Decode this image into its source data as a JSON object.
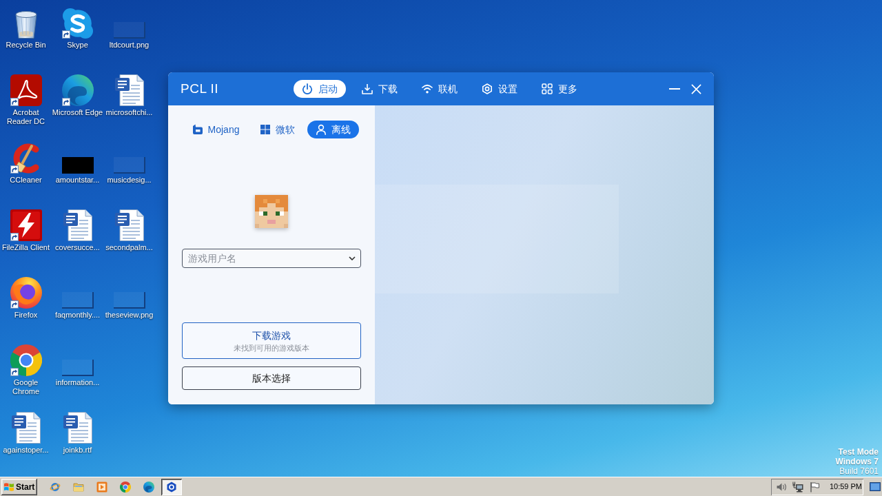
{
  "desktop": {
    "icons": [
      {
        "label": "Recycle Bin",
        "kind": "bin",
        "shortcut": false
      },
      {
        "label": "Acrobat Reader DC",
        "kind": "acrobat",
        "shortcut": true
      },
      {
        "label": "CCleaner",
        "kind": "ccleaner",
        "shortcut": true
      },
      {
        "label": "FileZilla Client",
        "kind": "filezilla",
        "shortcut": true
      },
      {
        "label": "Firefox",
        "kind": "firefox",
        "shortcut": true
      },
      {
        "label": "Google Chrome",
        "kind": "chrome",
        "shortcut": true
      },
      {
        "label": "againstoper...",
        "kind": "document",
        "shortcut": false
      },
      {
        "label": "Skype",
        "kind": "skype",
        "shortcut": true
      },
      {
        "label": "Microsoft Edge",
        "kind": "edge",
        "shortcut": true
      },
      {
        "label": "amountstar...",
        "kind": "darkimage",
        "shortcut": false
      },
      {
        "label": "coversucce...",
        "kind": "document",
        "shortcut": false
      },
      {
        "label": "faqmonthly....",
        "kind": "image",
        "shortcut": false
      },
      {
        "label": "information...",
        "kind": "image",
        "shortcut": false
      },
      {
        "label": "joinkb.rtf",
        "kind": "document",
        "shortcut": false
      },
      {
        "label": "ltdcourt.png",
        "kind": "image",
        "shortcut": false
      },
      {
        "label": "microsoftchi...",
        "kind": "document",
        "shortcut": false
      },
      {
        "label": "musicdesig...",
        "kind": "image",
        "shortcut": false
      },
      {
        "label": "secondpalm...",
        "kind": "document",
        "shortcut": false
      },
      {
        "label": "theseview.png",
        "kind": "image",
        "shortcut": false
      }
    ],
    "system_notice": {
      "mode": "Test Mode",
      "edition": "Windows 7",
      "build": "Build 7601"
    }
  },
  "window": {
    "title": "PCL II",
    "nav": [
      {
        "label": "启动",
        "kind": "launch",
        "selected": true
      },
      {
        "label": "下载",
        "kind": "download",
        "selected": false
      },
      {
        "label": "联机",
        "kind": "online",
        "selected": false
      },
      {
        "label": "设置",
        "kind": "settings",
        "selected": false
      },
      {
        "label": "更多",
        "kind": "more",
        "selected": false
      }
    ],
    "accounts": [
      {
        "label": "Mojang",
        "kind": "mojang",
        "selected": false
      },
      {
        "label": "微软",
        "kind": "microsoft",
        "selected": false
      },
      {
        "label": "离线",
        "kind": "offline",
        "selected": true
      }
    ],
    "username": {
      "placeholder": "游戏用户名"
    },
    "download_button": {
      "title": "下载游戏",
      "subtitle": "未找到可用的游戏版本"
    },
    "version_button": {
      "label": "版本选择"
    }
  },
  "taskbar": {
    "start": "Start",
    "pinned": [
      {
        "kind": "ie"
      },
      {
        "kind": "explorer"
      },
      {
        "kind": "mediaplayer"
      },
      {
        "kind": "chrome"
      },
      {
        "kind": "edge"
      }
    ],
    "tasks": [
      {
        "kind": "pcl",
        "selected": true
      }
    ],
    "clock": "10:59 PM"
  }
}
